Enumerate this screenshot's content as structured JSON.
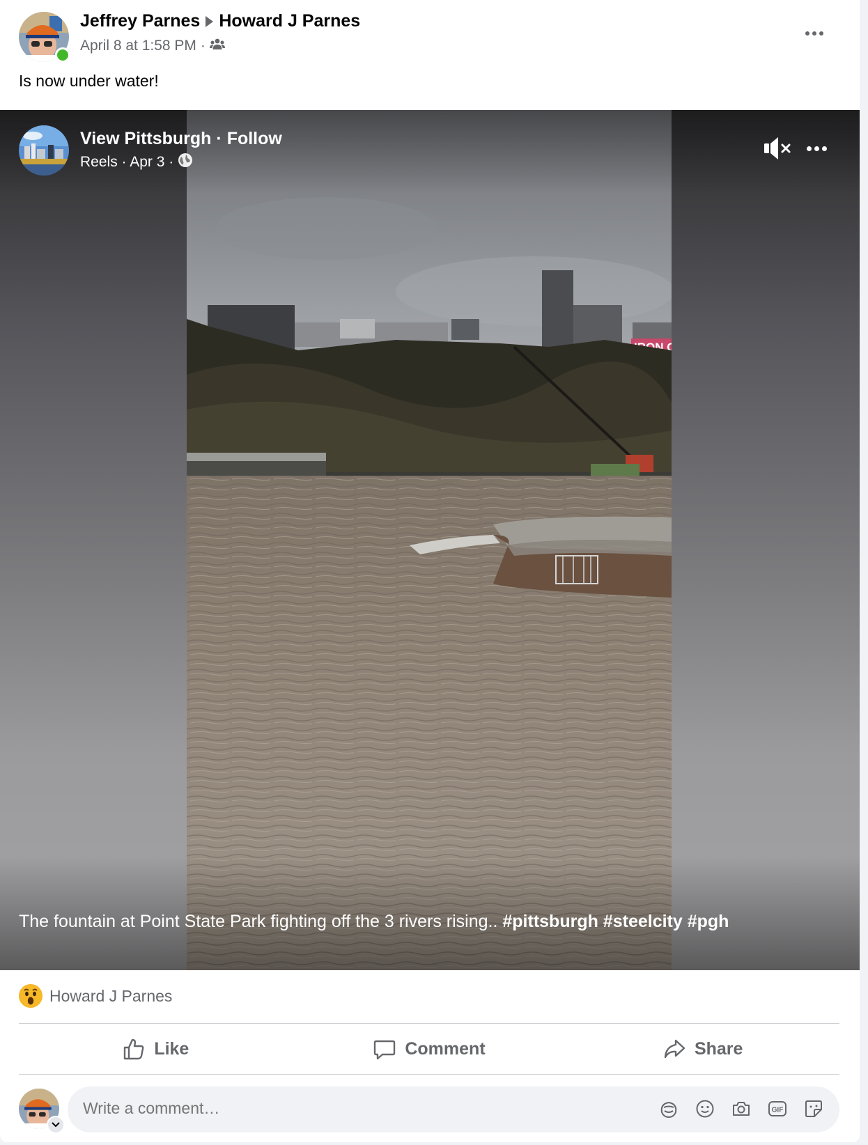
{
  "post": {
    "author": "Jeffrey Parnes",
    "recipient": "Howard J Parnes",
    "timestamp": "April 8 at 1:58 PM",
    "audience_icon": "friends-icon",
    "text": "Is now under water!"
  },
  "shared_reel": {
    "page_name": "View Pittsburgh",
    "follow_label": "Follow",
    "meta": "Reels · Apr 3 ·",
    "privacy_icon": "globe-icon",
    "caption_text": "The fountain at Point State Park fighting off the 3 rivers rising.. ",
    "caption_tags": "#pittsburgh #steelcity #pgh",
    "mute_icon": "speaker-muted-icon",
    "sign_text": "IRON C"
  },
  "reactions": {
    "emoji": "wow-emoji",
    "names": "Howard J Parnes"
  },
  "actions": {
    "like": "Like",
    "comment": "Comment",
    "share": "Share"
  },
  "comment_box": {
    "placeholder": "Write a comment…",
    "icons": [
      "avatar-sticker-icon",
      "emoji-icon",
      "camera-icon",
      "gif-icon",
      "sticker-icon"
    ]
  },
  "colors": {
    "secondary_text": "#65676b",
    "online": "#42b72a",
    "divider": "#ced0d4"
  }
}
